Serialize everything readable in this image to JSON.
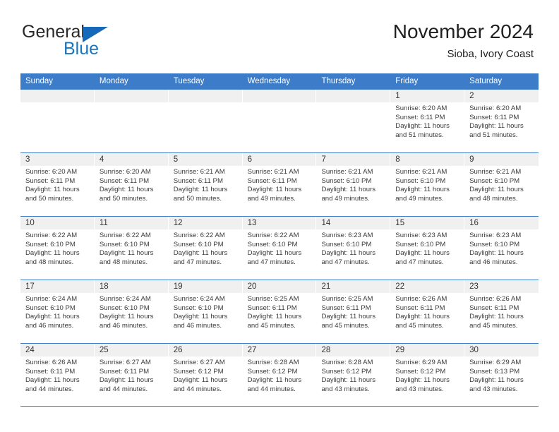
{
  "brand": {
    "name_part1": "General",
    "name_part2": "Blue",
    "color_dark": "#282828",
    "color_blue": "#1b75bb"
  },
  "header": {
    "title": "November 2024",
    "subtitle": "Sioba, Ivory Coast"
  },
  "theme": {
    "header_row_bg": "#3d7cc9",
    "day_band_bg": "#f0f0f0",
    "grid_line": "#3d7cc9",
    "text": "#3a3a3a"
  },
  "weekdays": [
    "Sunday",
    "Monday",
    "Tuesday",
    "Wednesday",
    "Thursday",
    "Friday",
    "Saturday"
  ],
  "weeks": [
    [
      {
        "day": "",
        "sunrise": "",
        "sunset": "",
        "daylight_line1": "",
        "daylight_line2": ""
      },
      {
        "day": "",
        "sunrise": "",
        "sunset": "",
        "daylight_line1": "",
        "daylight_line2": ""
      },
      {
        "day": "",
        "sunrise": "",
        "sunset": "",
        "daylight_line1": "",
        "daylight_line2": ""
      },
      {
        "day": "",
        "sunrise": "",
        "sunset": "",
        "daylight_line1": "",
        "daylight_line2": ""
      },
      {
        "day": "",
        "sunrise": "",
        "sunset": "",
        "daylight_line1": "",
        "daylight_line2": ""
      },
      {
        "day": "1",
        "sunrise": "Sunrise: 6:20 AM",
        "sunset": "Sunset: 6:11 PM",
        "daylight_line1": "Daylight: 11 hours",
        "daylight_line2": "and 51 minutes."
      },
      {
        "day": "2",
        "sunrise": "Sunrise: 6:20 AM",
        "sunset": "Sunset: 6:11 PM",
        "daylight_line1": "Daylight: 11 hours",
        "daylight_line2": "and 51 minutes."
      }
    ],
    [
      {
        "day": "3",
        "sunrise": "Sunrise: 6:20 AM",
        "sunset": "Sunset: 6:11 PM",
        "daylight_line1": "Daylight: 11 hours",
        "daylight_line2": "and 50 minutes."
      },
      {
        "day": "4",
        "sunrise": "Sunrise: 6:20 AM",
        "sunset": "Sunset: 6:11 PM",
        "daylight_line1": "Daylight: 11 hours",
        "daylight_line2": "and 50 minutes."
      },
      {
        "day": "5",
        "sunrise": "Sunrise: 6:21 AM",
        "sunset": "Sunset: 6:11 PM",
        "daylight_line1": "Daylight: 11 hours",
        "daylight_line2": "and 50 minutes."
      },
      {
        "day": "6",
        "sunrise": "Sunrise: 6:21 AM",
        "sunset": "Sunset: 6:11 PM",
        "daylight_line1": "Daylight: 11 hours",
        "daylight_line2": "and 49 minutes."
      },
      {
        "day": "7",
        "sunrise": "Sunrise: 6:21 AM",
        "sunset": "Sunset: 6:10 PM",
        "daylight_line1": "Daylight: 11 hours",
        "daylight_line2": "and 49 minutes."
      },
      {
        "day": "8",
        "sunrise": "Sunrise: 6:21 AM",
        "sunset": "Sunset: 6:10 PM",
        "daylight_line1": "Daylight: 11 hours",
        "daylight_line2": "and 49 minutes."
      },
      {
        "day": "9",
        "sunrise": "Sunrise: 6:21 AM",
        "sunset": "Sunset: 6:10 PM",
        "daylight_line1": "Daylight: 11 hours",
        "daylight_line2": "and 48 minutes."
      }
    ],
    [
      {
        "day": "10",
        "sunrise": "Sunrise: 6:22 AM",
        "sunset": "Sunset: 6:10 PM",
        "daylight_line1": "Daylight: 11 hours",
        "daylight_line2": "and 48 minutes."
      },
      {
        "day": "11",
        "sunrise": "Sunrise: 6:22 AM",
        "sunset": "Sunset: 6:10 PM",
        "daylight_line1": "Daylight: 11 hours",
        "daylight_line2": "and 48 minutes."
      },
      {
        "day": "12",
        "sunrise": "Sunrise: 6:22 AM",
        "sunset": "Sunset: 6:10 PM",
        "daylight_line1": "Daylight: 11 hours",
        "daylight_line2": "and 47 minutes."
      },
      {
        "day": "13",
        "sunrise": "Sunrise: 6:22 AM",
        "sunset": "Sunset: 6:10 PM",
        "daylight_line1": "Daylight: 11 hours",
        "daylight_line2": "and 47 minutes."
      },
      {
        "day": "14",
        "sunrise": "Sunrise: 6:23 AM",
        "sunset": "Sunset: 6:10 PM",
        "daylight_line1": "Daylight: 11 hours",
        "daylight_line2": "and 47 minutes."
      },
      {
        "day": "15",
        "sunrise": "Sunrise: 6:23 AM",
        "sunset": "Sunset: 6:10 PM",
        "daylight_line1": "Daylight: 11 hours",
        "daylight_line2": "and 47 minutes."
      },
      {
        "day": "16",
        "sunrise": "Sunrise: 6:23 AM",
        "sunset": "Sunset: 6:10 PM",
        "daylight_line1": "Daylight: 11 hours",
        "daylight_line2": "and 46 minutes."
      }
    ],
    [
      {
        "day": "17",
        "sunrise": "Sunrise: 6:24 AM",
        "sunset": "Sunset: 6:10 PM",
        "daylight_line1": "Daylight: 11 hours",
        "daylight_line2": "and 46 minutes."
      },
      {
        "day": "18",
        "sunrise": "Sunrise: 6:24 AM",
        "sunset": "Sunset: 6:10 PM",
        "daylight_line1": "Daylight: 11 hours",
        "daylight_line2": "and 46 minutes."
      },
      {
        "day": "19",
        "sunrise": "Sunrise: 6:24 AM",
        "sunset": "Sunset: 6:10 PM",
        "daylight_line1": "Daylight: 11 hours",
        "daylight_line2": "and 46 minutes."
      },
      {
        "day": "20",
        "sunrise": "Sunrise: 6:25 AM",
        "sunset": "Sunset: 6:11 PM",
        "daylight_line1": "Daylight: 11 hours",
        "daylight_line2": "and 45 minutes."
      },
      {
        "day": "21",
        "sunrise": "Sunrise: 6:25 AM",
        "sunset": "Sunset: 6:11 PM",
        "daylight_line1": "Daylight: 11 hours",
        "daylight_line2": "and 45 minutes."
      },
      {
        "day": "22",
        "sunrise": "Sunrise: 6:26 AM",
        "sunset": "Sunset: 6:11 PM",
        "daylight_line1": "Daylight: 11 hours",
        "daylight_line2": "and 45 minutes."
      },
      {
        "day": "23",
        "sunrise": "Sunrise: 6:26 AM",
        "sunset": "Sunset: 6:11 PM",
        "daylight_line1": "Daylight: 11 hours",
        "daylight_line2": "and 45 minutes."
      }
    ],
    [
      {
        "day": "24",
        "sunrise": "Sunrise: 6:26 AM",
        "sunset": "Sunset: 6:11 PM",
        "daylight_line1": "Daylight: 11 hours",
        "daylight_line2": "and 44 minutes."
      },
      {
        "day": "25",
        "sunrise": "Sunrise: 6:27 AM",
        "sunset": "Sunset: 6:11 PM",
        "daylight_line1": "Daylight: 11 hours",
        "daylight_line2": "and 44 minutes."
      },
      {
        "day": "26",
        "sunrise": "Sunrise: 6:27 AM",
        "sunset": "Sunset: 6:12 PM",
        "daylight_line1": "Daylight: 11 hours",
        "daylight_line2": "and 44 minutes."
      },
      {
        "day": "27",
        "sunrise": "Sunrise: 6:28 AM",
        "sunset": "Sunset: 6:12 PM",
        "daylight_line1": "Daylight: 11 hours",
        "daylight_line2": "and 44 minutes."
      },
      {
        "day": "28",
        "sunrise": "Sunrise: 6:28 AM",
        "sunset": "Sunset: 6:12 PM",
        "daylight_line1": "Daylight: 11 hours",
        "daylight_line2": "and 43 minutes."
      },
      {
        "day": "29",
        "sunrise": "Sunrise: 6:29 AM",
        "sunset": "Sunset: 6:12 PM",
        "daylight_line1": "Daylight: 11 hours",
        "daylight_line2": "and 43 minutes."
      },
      {
        "day": "30",
        "sunrise": "Sunrise: 6:29 AM",
        "sunset": "Sunset: 6:13 PM",
        "daylight_line1": "Daylight: 11 hours",
        "daylight_line2": "and 43 minutes."
      }
    ]
  ]
}
